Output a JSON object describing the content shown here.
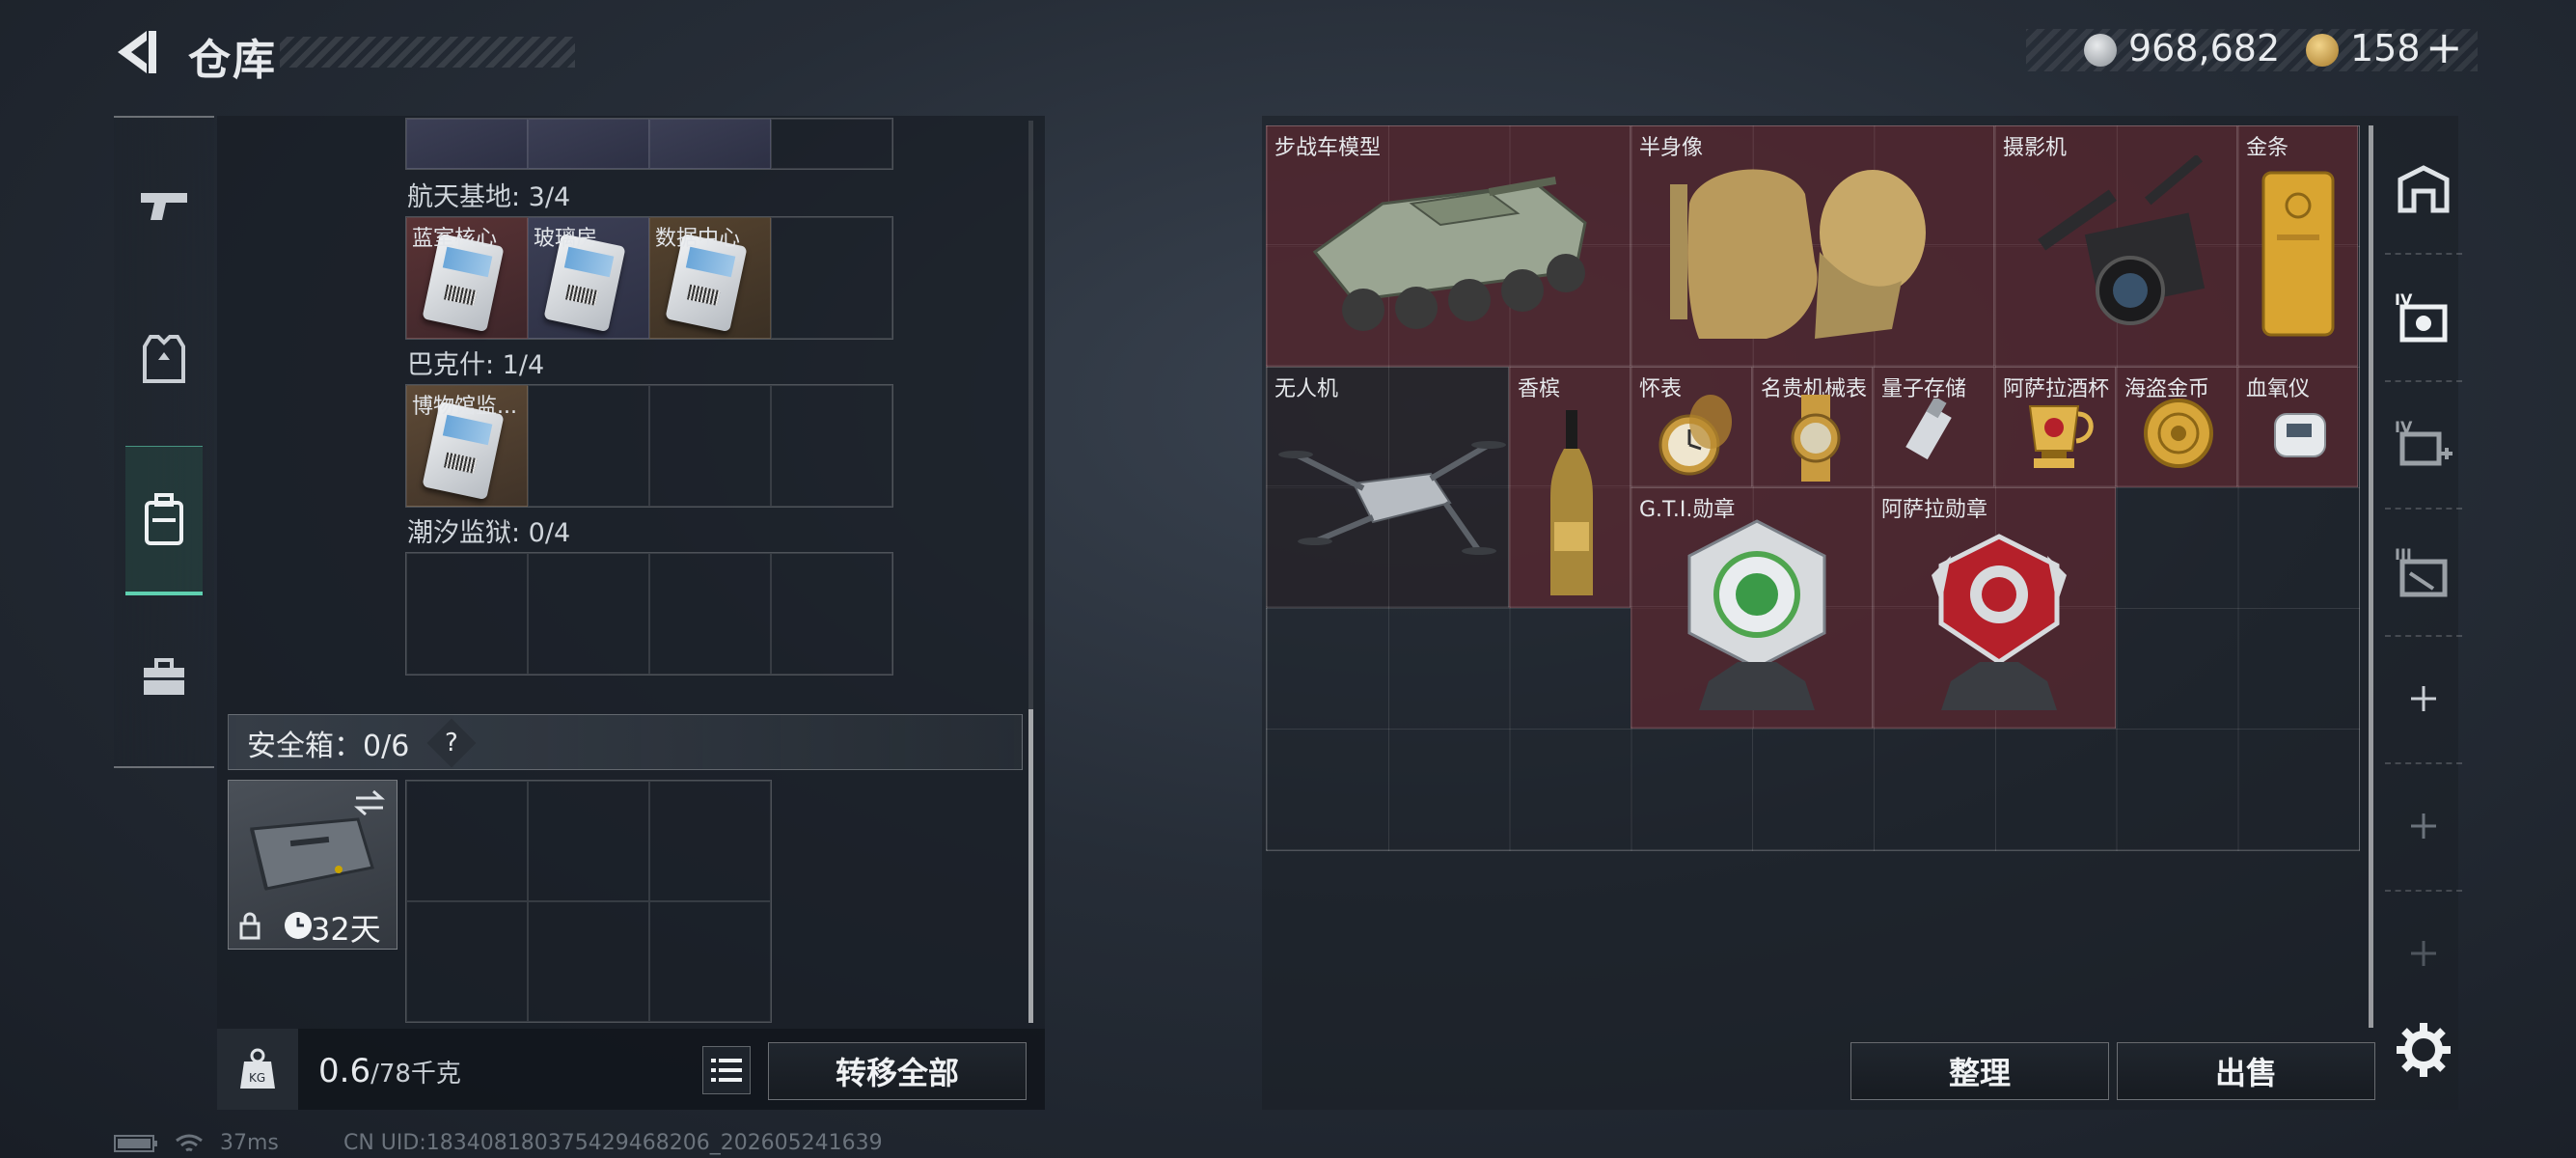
{
  "header": {
    "title": "仓库",
    "currency1": "968,682",
    "currency2": "158",
    "plus": "+"
  },
  "storage": {
    "sections": [
      {
        "label": "航天基地: 3/4",
        "items": [
          "蓝室核心",
          "玻璃房",
          "数据中心"
        ]
      },
      {
        "label": "巴克什: 1/4",
        "items": [
          "博物馆监..."
        ]
      },
      {
        "label": "潮汐监狱: 0/4",
        "items": []
      }
    ],
    "safe_box_label": "安全箱：0/6",
    "safe_help": "?",
    "case_days": "32天",
    "weight": "0.6",
    "weight_max": "/78千克",
    "transfer_all": "转移全部"
  },
  "items": [
    {
      "name": "步战车模型"
    },
    {
      "name": "半身像"
    },
    {
      "name": "摄影机"
    },
    {
      "name": "金条"
    },
    {
      "name": "无人机"
    },
    {
      "name": "香槟"
    },
    {
      "name": "怀表"
    },
    {
      "name": "名贵机械表"
    },
    {
      "name": "量子存储"
    },
    {
      "name": "阿萨拉酒杯"
    },
    {
      "name": "海盗金币"
    },
    {
      "name": "血氧仪"
    },
    {
      "name": "G.T.I.勋章"
    },
    {
      "name": "阿萨拉勋章"
    }
  ],
  "actions": {
    "sort": "整理",
    "sell": "出售"
  },
  "right_tabs": [
    "home-icon",
    "level4-bag-icon",
    "level4-add-icon",
    "level3-bag-icon",
    "plus-icon",
    "plus-icon",
    "plus-icon"
  ],
  "status": {
    "ping": "37ms",
    "uid": "CN UID:1834081803754294682​06_202605241639"
  },
  "colors": {
    "accent": "#5fd0b0",
    "item_bg": "#5c2830"
  }
}
